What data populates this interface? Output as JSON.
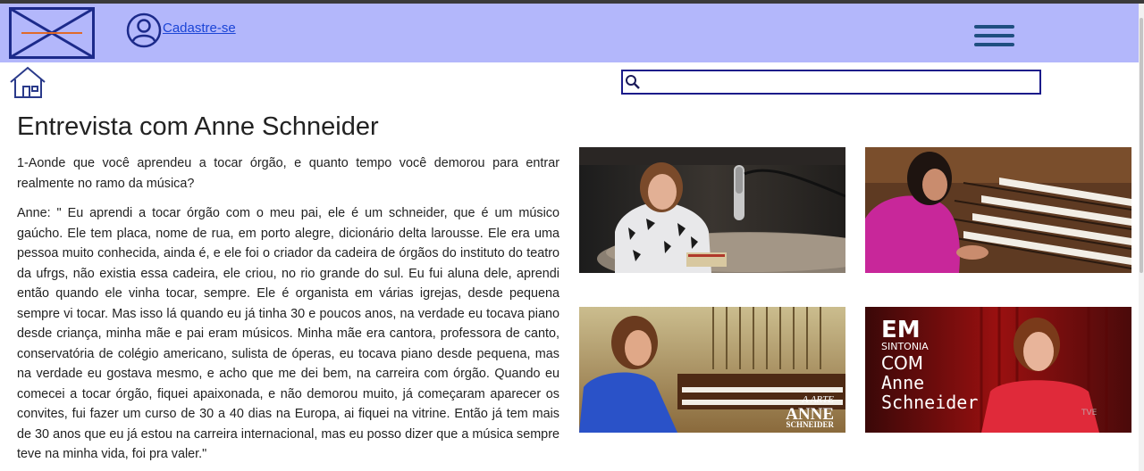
{
  "header": {
    "signup_label": "Cadastre-se",
    "logo_icon": "logo-x-icon",
    "user_icon": "user-icon",
    "menu_icon": "hamburger-menu-icon",
    "background": "#b3b7fb"
  },
  "nav": {
    "home_icon": "home-icon"
  },
  "search": {
    "value": "",
    "icon": "search-icon"
  },
  "article": {
    "title": "Entrevista com Anne Schneider",
    "question": "1-Aonde que você aprendeu a tocar órgão, e quanto tempo você demorou para entrar realmente no ramo da música?",
    "answer": "Anne: \" Eu aprendi a tocar órgão com o meu pai, ele é um schneider, que é um músico gaúcho. Ele tem placa, nome de rua, em porto alegre, dicionário delta larousse. Ele era uma pessoa muito conhecida, ainda é, e ele foi o criador da cadeira de órgãos do instituto do teatro da ufrgs, não existia essa cadeira, ele criou, no rio grande do sul. Eu fui aluna dele, aprendi então quando ele vinha tocar, sempre. Ele é organista em várias igrejas, desde pequena sempre vi tocar. Mas isso lá quando eu já tinha 30 e poucos anos, na verdade eu tocava piano desde criança, minha mãe e pai eram músicos. Minha mãe era cantora, professora de canto, conservatória de colégio americano, sulista de óperas, eu tocava piano desde pequena, mas na verdade eu gostava mesmo, e acho que me dei bem, na carreira com órgão. Quando eu comecei a tocar órgão, fiquei apaixonada, e não demorou muito, já começaram aparecer os convites, fui fazer um curso de 30 a 40 dias na Europa, ai fiquei na vitrine. Então já tem mais de 30 anos que eu já estou na carreira internacional, mas eu posso dizer que a música sempre teve na minha vida, foi pra valer.\""
  },
  "gallery": {
    "photo3_caption_1": "A ARTE",
    "photo3_caption_2": "ANNE",
    "photo3_caption_3": "SCHNEIDER",
    "photo4_line1": "EM",
    "photo4_line2": "SINTONIA",
    "photo4_line3": "COM",
    "photo4_line4": "Anne",
    "photo4_line5": "Schneider",
    "photo4_logo": "TVE"
  }
}
